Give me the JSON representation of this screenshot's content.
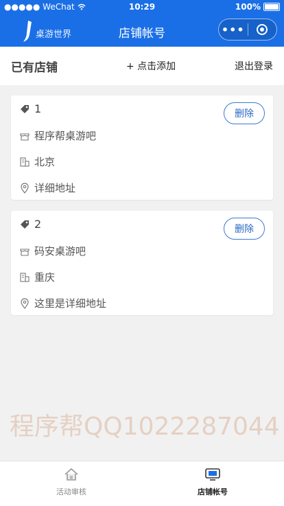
{
  "status_bar": {
    "carrier": "●●●●● WeChat",
    "time": "10:29",
    "battery": "100%"
  },
  "nav": {
    "logo_text": "桌游世界",
    "title": "店铺帐号",
    "capsule_more": "•••"
  },
  "header": {
    "title": "已有店铺",
    "add_label": "+ 点击添加",
    "logout_label": "退出登录"
  },
  "stores": [
    {
      "id": "1",
      "name": "程序帮桌游吧",
      "city": "北京",
      "address": "详细地址",
      "delete_label": "删除"
    },
    {
      "id": "2",
      "name": "码安桌游吧",
      "city": "重庆",
      "address": "这里是详细地址",
      "delete_label": "删除"
    }
  ],
  "watermark": "程序帮QQ1022287044",
  "tabs": [
    {
      "label": "活动审核",
      "icon": "home-icon",
      "active": false
    },
    {
      "label": "店铺帐号",
      "icon": "monitor-icon",
      "active": true
    }
  ],
  "colors": {
    "brand_blue": "#1a6fe6",
    "button_border": "#3a78d6",
    "background": "#f1f1f1"
  }
}
